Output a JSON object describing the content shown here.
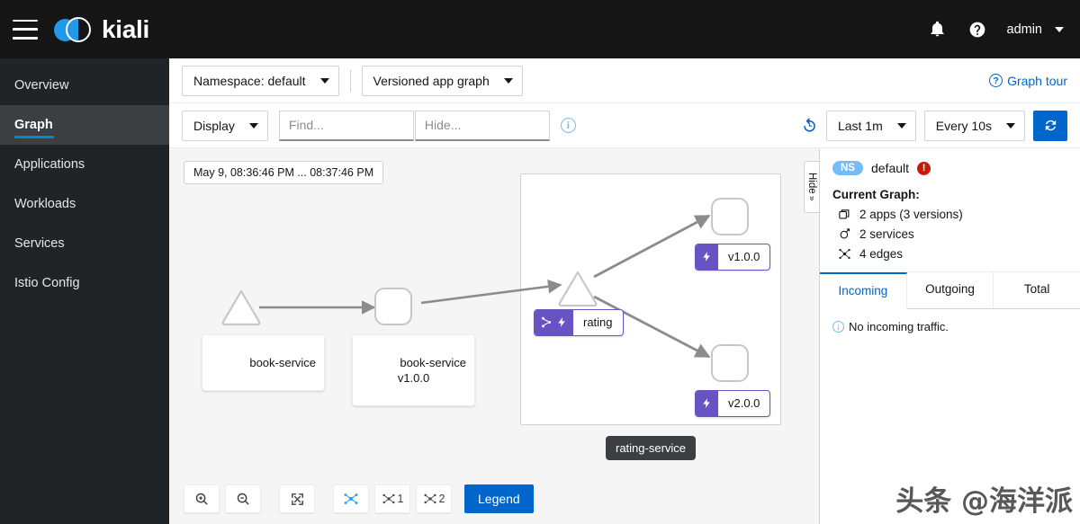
{
  "masthead": {
    "brand_name": "kiali",
    "menu_icon": "hamburger-icon",
    "notification_icon": "bell-icon",
    "help_icon": "help-circle-icon",
    "user_name": "admin"
  },
  "sidebar": {
    "items": [
      {
        "label": "Overview",
        "active": false
      },
      {
        "label": "Graph",
        "active": true
      },
      {
        "label": "Applications",
        "active": false
      },
      {
        "label": "Workloads",
        "active": false
      },
      {
        "label": "Services",
        "active": false
      },
      {
        "label": "Istio Config",
        "active": false
      }
    ]
  },
  "toolbar_top": {
    "namespace_select": "Namespace: default",
    "graph_type_select": "Versioned app graph",
    "graph_tour_label": "Graph tour",
    "graph_tour_icon": "question-circle-icon"
  },
  "toolbar_second": {
    "display_label": "Display",
    "find_placeholder": "Find...",
    "hide_placeholder": "Hide...",
    "find_value": "",
    "hide_value": "",
    "info_icon": "info-circle-icon",
    "history_icon": "replay-history-icon",
    "time_range": "Last 1m",
    "refresh_interval": "Every 10s",
    "refresh_icon": "sync-refresh-icon"
  },
  "graph": {
    "time_chip": "May 9, 08:36:46 PM ... 08:37:46 PM",
    "hide_handle_label": "Hide",
    "hide_handle_chevron": "»",
    "tooltip": "rating-service",
    "nodes": [
      {
        "id": "book-service-svc",
        "shape": "triangle",
        "label": "book-service",
        "badges": []
      },
      {
        "id": "book-service-v1",
        "shape": "square",
        "label": "book-service\nv1.0.0",
        "badges": []
      },
      {
        "id": "rating-svc",
        "shape": "triangle",
        "label": "rating",
        "badges": [
          "virtual-service-icon",
          "destination-rule-icon"
        ]
      },
      {
        "id": "rating-v1",
        "shape": "square",
        "label": "v1.0.0",
        "badges": [
          "destination-rule-icon"
        ]
      },
      {
        "id": "rating-v2",
        "shape": "square",
        "label": "v2.0.0",
        "badges": [
          "destination-rule-icon"
        ]
      }
    ],
    "bottom_toolbar": {
      "zoom_in": "zoom-in-icon",
      "zoom_out": "zoom-out-icon",
      "fit_screen": "fit-to-screen-icon",
      "layout_default": "layout-graph-icon",
      "layout_1_label": "1",
      "layout_2_label": "2",
      "legend_label": "Legend"
    }
  },
  "side_panel": {
    "ns_badge": "NS",
    "ns_name": "default",
    "error_badge": "!",
    "current_graph_title": "Current Graph:",
    "stats": [
      {
        "icon": "apps-icon",
        "text": "2 apps (3 versions)"
      },
      {
        "icon": "service-icon",
        "text": "2 services"
      },
      {
        "icon": "edges-icon",
        "text": "4 edges"
      }
    ],
    "tabs": [
      {
        "label": "Incoming",
        "active": true
      },
      {
        "label": "Outgoing",
        "active": false
      },
      {
        "label": "Total",
        "active": false
      }
    ],
    "note": "No incoming traffic.",
    "note_icon": "info-circle-icon"
  },
  "watermark": {
    "text": "头条 @海洋派"
  },
  "colors": {
    "brand_blue": "#2199e8",
    "primary_blue": "#06c",
    "masthead_bg": "#151515",
    "sidebar_bg": "#212427",
    "badge_purple": "#6753c4",
    "error_red": "#c9190b"
  }
}
